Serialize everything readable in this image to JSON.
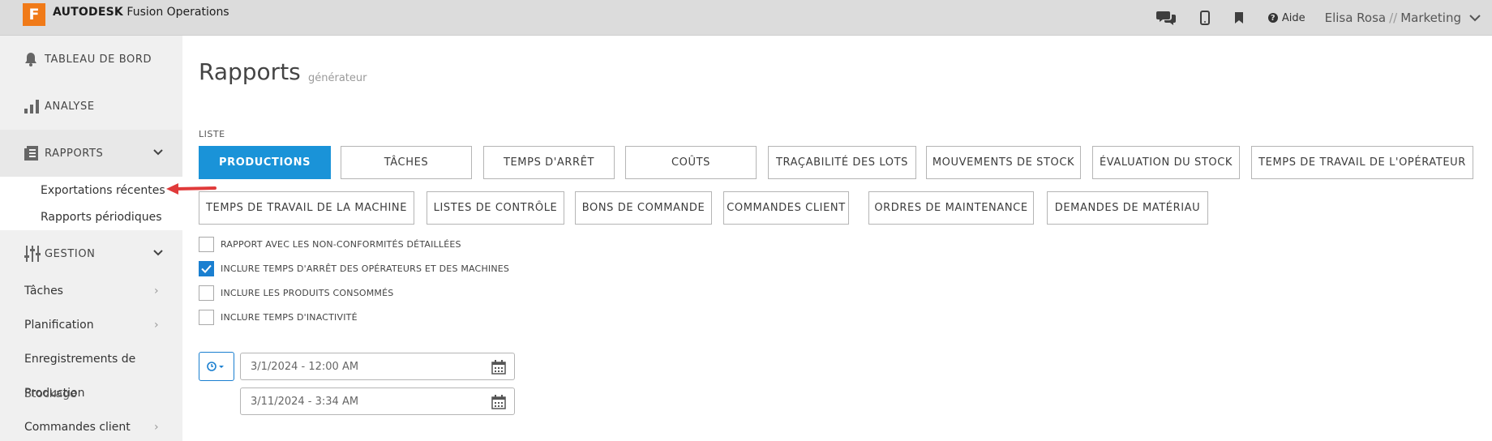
{
  "app": {
    "logo_letter": "F",
    "brand_bold": "AUTODESK",
    "brand_name": "Fusion Operations"
  },
  "topbar": {
    "icons": [
      "chat-icon",
      "mobile-icon",
      "bookmark-icon"
    ],
    "help_label": "Aide",
    "user_name": "Elisa Rosa",
    "user_separator": "//",
    "user_dept": "Marketing"
  },
  "sidebar": {
    "dashboard": "TABLEAU DE BORD",
    "analysis": "ANALYSE",
    "reports": "RAPPORTS",
    "reports_sub": [
      "Exportations récentes",
      "Rapports périodiques"
    ],
    "management": "GESTION",
    "items": [
      "Tâches",
      "Planification",
      "Enregistrements de",
      "Commandes client"
    ],
    "overlap_text_a": "Production",
    "overlap_text_b": "Stockage",
    "accent_arrow_color": "#e03a3a"
  },
  "main": {
    "title": "Rapports",
    "subtitle": "générateur",
    "list_label": "LISTE",
    "tabs_row1": [
      "PRODUCTIONS",
      "TÂCHES",
      "TEMPS D'ARRÊT",
      "COÛTS",
      "TRAÇABILITÉ DES LOTS",
      "MOUVEMENTS DE STOCK",
      "ÉVALUATION DU STOCK",
      "TEMPS DE TRAVAIL DE L'OPÉRATEUR"
    ],
    "tabs_row2": [
      "TEMPS DE TRAVAIL DE LA MACHINE",
      "LISTES DE CONTRÔLE",
      "BONS DE COMMANDE",
      "COMMANDES CLIENT",
      "ORDRES DE MAINTENANCE",
      "DEMANDES DE MATÉRIAU"
    ],
    "active_tab": "PRODUCTIONS",
    "options": [
      {
        "label": "RAPPORT AVEC LES NON-CONFORMITÉS DÉTAILLÉES",
        "checked": false
      },
      {
        "label": "INCLURE TEMPS D'ARRÊT DES OPÉRATEURS ET DES MACHINES",
        "checked": true
      },
      {
        "label": "INCLURE LES PRODUITS CONSOMMÉS",
        "checked": false
      },
      {
        "label": "INCLURE TEMPS D'INACTIVITÉ",
        "checked": false
      }
    ],
    "date_from": "3/1/2024 - 12:00 AM",
    "date_to": "3/11/2024 - 3:34 AM",
    "accent_color": "#1a93d8"
  }
}
